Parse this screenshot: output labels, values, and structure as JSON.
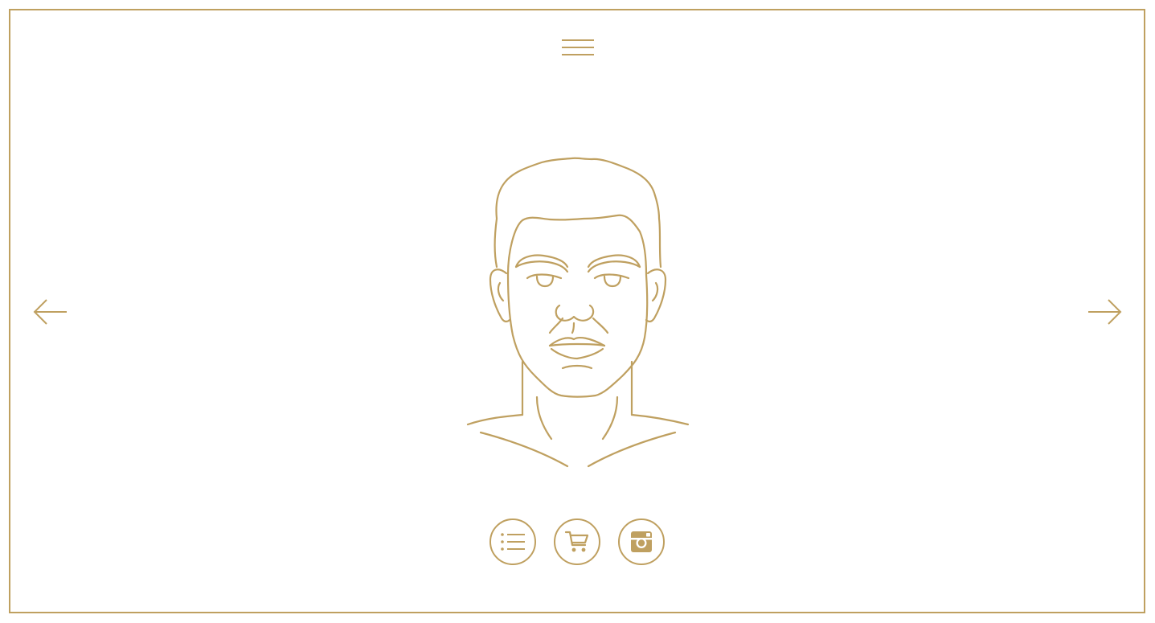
{
  "theme": {
    "accent_color": "#bfa060",
    "background_color": "#ffffff"
  },
  "header": {
    "menu_icon": "hamburger-icon"
  },
  "navigation": {
    "prev_icon": "arrow-left-icon",
    "next_icon": "arrow-right-icon"
  },
  "hero": {
    "illustration": "male-face-line-art"
  },
  "footer_actions": [
    {
      "icon": "list-icon"
    },
    {
      "icon": "cart-icon"
    },
    {
      "icon": "instagram-icon"
    }
  ]
}
